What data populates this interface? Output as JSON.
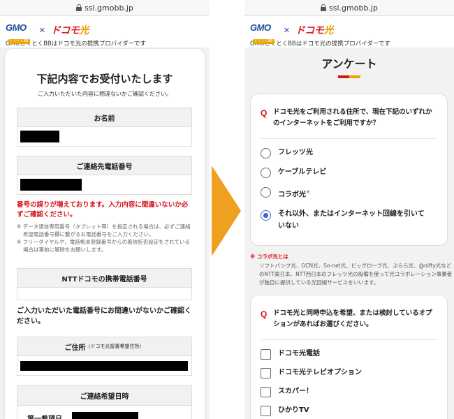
{
  "url": "ssl.gmobb.jp",
  "brand": {
    "gmo": "GMO",
    "gmo_sub": "とくとくBB",
    "times": "×",
    "docomo": "ドコモ",
    "hikari": "光",
    "provider_text": "GMOとくとくBBはドコモ光の提携プロバイダーです"
  },
  "left": {
    "title": "下記内容でお受付いたします",
    "subtitle": "ご入力いただいた内容に相違ないかご確認ください。",
    "name_label": "お名前",
    "phone_label": "ご連絡先電話番号",
    "warning": "番号の誤りが増えております。入力内容に間違いないか必ずご確認ください。",
    "notes": [
      "※ データ通信専用番号（タブレット等）を指定される場合は、必ずご連絡希望電話番号欄に繋がるお電話番号をご入力ください。",
      "※ フリーダイヤルや、電話帳未登録番号からの着信拒否設定をされている場合は事前に解除をお願いします。"
    ],
    "ntt_label": "NTTドコモの携帯電話番号",
    "confirm_text": "ご入力いただいた電話番号にお間違いがないかご確認ください。",
    "address_label": "ご住所",
    "address_sub": "（ドコモ光設置希望住所）",
    "date_label": "ご連絡希望日時",
    "first_choice": "第一希望日"
  },
  "right": {
    "title": "アンケート",
    "q_mark": "Q",
    "q1_text": "ドコモ光をご利用される住所で、現在下記のいずれかのインターネットをご利用ですか？",
    "q1_options": [
      "フレッツ光",
      "ケーブルテレビ",
      "コラボ光",
      "それ以外、またはインターネット回線を引いていない"
    ],
    "collab_mark": "※",
    "footnote_title": "※ コラボ光とは",
    "footnote_body": "ソフトバンク光、OCN光、So-net光、ビッグローブ光、ぷらら光、@nifty光などのNTT東日本、NTT西日本のフレッツ光の設備を使って光コラボレーション事業者が独自に提供している光回線サービスをいいます。",
    "q2_text": "ドコモ光と同時申込を希望、または検討しているオプションがあればお選びください。",
    "q2_options": [
      "ドコモ光電話",
      "ドコモ光テレビオプション",
      "スカパー！",
      "ひかりTV"
    ]
  },
  "colors": {
    "accent_red": "#d4141c",
    "accent_yellow": "#e8a300",
    "arrow_orange": "#f0a020",
    "radio_selected": "#3a66d0"
  },
  "q1_selected_index": 3
}
